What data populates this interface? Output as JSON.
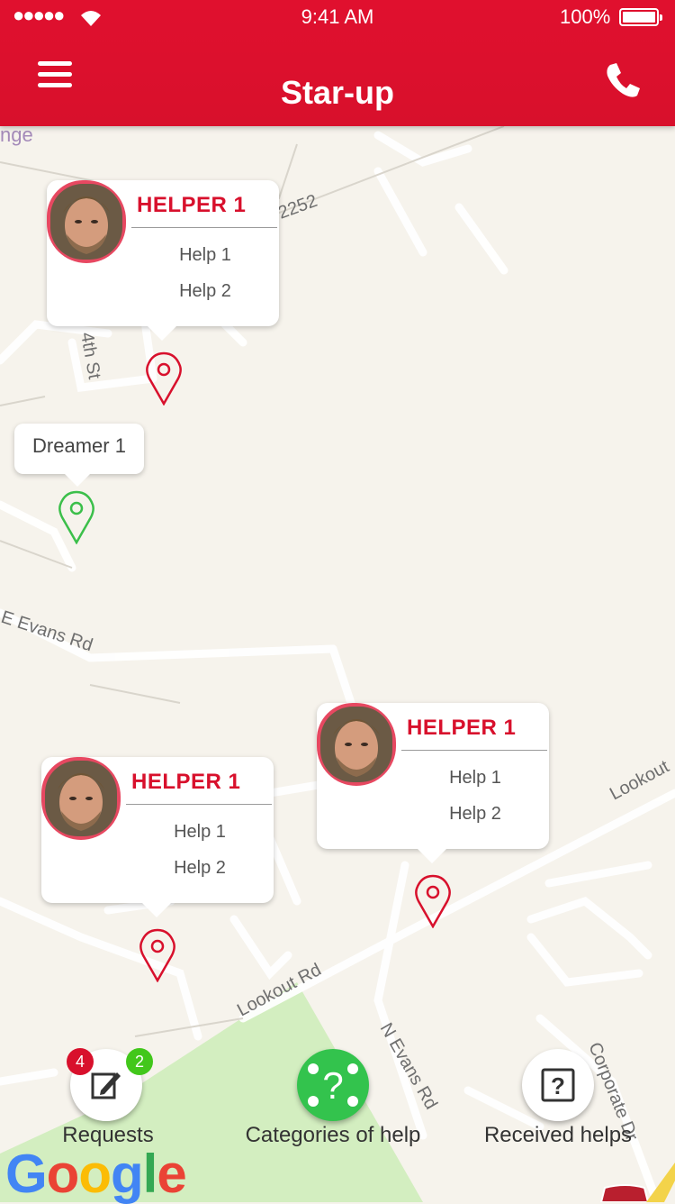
{
  "status_bar": {
    "signal": "●●●●●",
    "time": "9:41 AM",
    "battery": "100%"
  },
  "header": {
    "title": "Star-up"
  },
  "map": {
    "street_labels": [
      "nge",
      "2252",
      "4th St",
      "E Evans Rd",
      "Lookout Rd",
      "N Evans Rd",
      "Corporate Dr",
      "Lookout"
    ],
    "helpers": [
      {
        "name": "HELPER 1",
        "help1": "Help 1",
        "help2": "Help 2"
      },
      {
        "name": "HELPER 1",
        "help1": "Help 1",
        "help2": "Help 2"
      },
      {
        "name": "HELPER 1",
        "help1": "Help 1",
        "help2": "Help 2"
      }
    ],
    "dreamer": {
      "name": "Dreamer 1"
    }
  },
  "bottom_nav": {
    "requests": {
      "label": "Requests",
      "badge_red": "4",
      "badge_green": "2"
    },
    "categories": {
      "label": "Categories of help",
      "glyph": "?"
    },
    "received": {
      "label": "Received helps",
      "glyph": "?"
    }
  },
  "google_logo": [
    "G",
    "o",
    "o",
    "g",
    "l",
    "e"
  ],
  "colors": {
    "brand_red": "#d8102c",
    "pin_green": "#3bbf4a",
    "fab_green": "#33c34d",
    "map_bg": "#f6f3ec",
    "park": "#d3eec0"
  }
}
